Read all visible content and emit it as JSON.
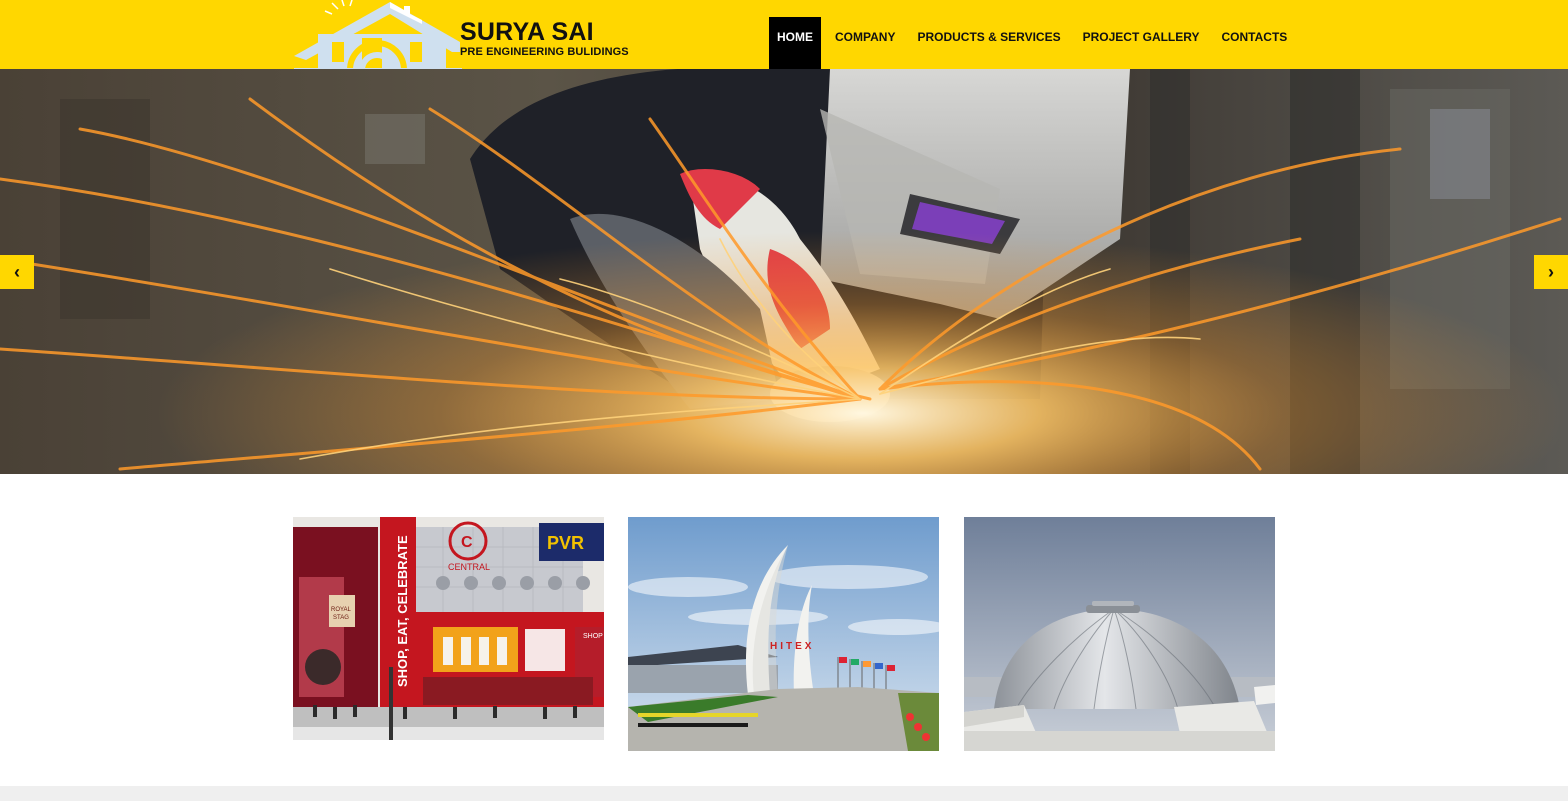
{
  "brand": {
    "name": "SURYA SAI",
    "tagline": "PRE ENGINEERING BULIDINGS"
  },
  "nav": {
    "items": [
      {
        "label": "HOME",
        "active": true
      },
      {
        "label": "COMPANY"
      },
      {
        "label": "PRODUCTS & SERVICES"
      },
      {
        "label": "PROJECT GALLERY"
      },
      {
        "label": "CONTACTS"
      }
    ]
  },
  "slider": {
    "prev_icon": "chevron-left-icon",
    "next_icon": "chevron-right-icon",
    "prev_glyph": "‹",
    "next_glyph": "›"
  },
  "gallery": {
    "images": [
      {
        "subject": "shopping mall facade",
        "signs": [
          "SHOP, EAT, CELEBRATE",
          "CENTRAL",
          "PVR",
          "ROYAL STAG",
          "SHOP"
        ]
      },
      {
        "subject": "tusk arch gateway",
        "signs": [
          "HITEX"
        ]
      },
      {
        "subject": "metal dome roof"
      }
    ]
  },
  "colors": {
    "brand_yellow": "#FFD700",
    "active_nav": "#000000",
    "text": "#111111",
    "footer_strip": "#efefef"
  }
}
